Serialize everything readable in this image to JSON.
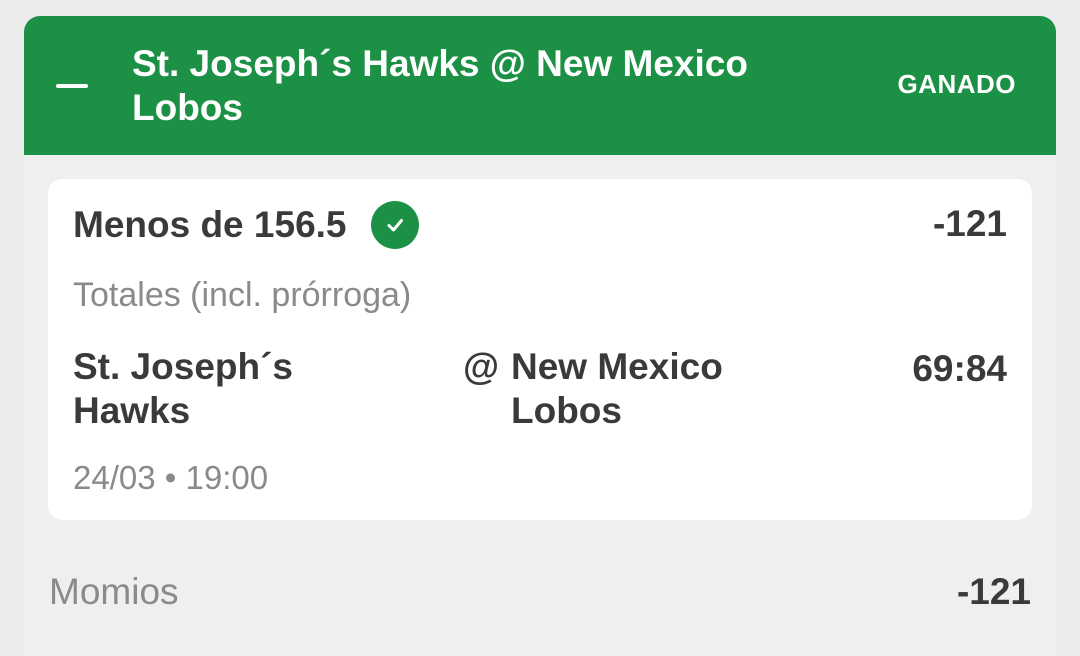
{
  "header": {
    "title": "St. Joseph´s Hawks @ New Mexico Lobos",
    "status": "GANADO",
    "collapse_icon": "minus-icon",
    "color": "#1c9145"
  },
  "bet": {
    "selection": "Menos de 156.5",
    "status_icon": "check-circle-icon",
    "odds": "-121",
    "market": "Totales (incl. prórroga)",
    "home_team": "St. Joseph´s Hawks",
    "separator": "@",
    "away_team": "New Mexico Lobos",
    "score": "69:84",
    "date": "24/03",
    "dot": "•",
    "time": "19:00"
  },
  "footer": {
    "label": "Momios",
    "odds": "-121"
  }
}
